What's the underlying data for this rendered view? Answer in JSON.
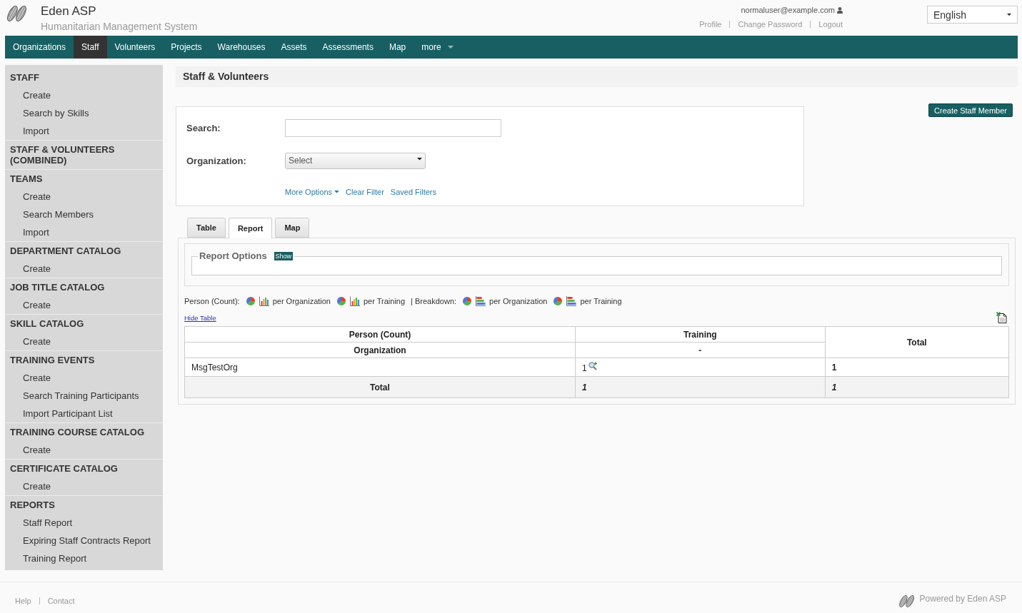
{
  "header": {
    "title": "Eden ASP",
    "subtitle": "Humanitarian Management System",
    "user_email": "normaluser@example.com",
    "user_links": [
      "Profile",
      "Change Password",
      "Logout"
    ],
    "language": "English"
  },
  "nav": [
    {
      "label": "Organizations",
      "kind": "link",
      "selected": false
    },
    {
      "label": "Staff",
      "kind": "link",
      "selected": true
    },
    {
      "label": "Volunteers",
      "kind": "link",
      "selected": false
    },
    {
      "label": "Projects",
      "kind": "link",
      "selected": false
    },
    {
      "label": "Warehouses",
      "kind": "link",
      "selected": false
    },
    {
      "label": "Assets",
      "kind": "link",
      "selected": false
    },
    {
      "label": "Assessments",
      "kind": "link",
      "selected": false
    },
    {
      "label": "Map",
      "kind": "link",
      "selected": false
    },
    {
      "label": "more",
      "kind": "menu",
      "selected": false
    }
  ],
  "sidebar": [
    {
      "heading": "STAFF",
      "items": [
        "Create",
        "Search by Skills",
        "Import"
      ]
    },
    {
      "heading": "STAFF & VOLUNTEERS (COMBINED)"
    },
    {
      "heading": "TEAMS",
      "items": [
        "Create",
        "Search Members",
        "Import"
      ]
    },
    {
      "heading": "DEPARTMENT CATALOG",
      "items": [
        "Create"
      ]
    },
    {
      "heading": "JOB TITLE CATALOG",
      "items": [
        "Create"
      ]
    },
    {
      "heading": "SKILL CATALOG",
      "items": [
        "Create"
      ]
    },
    {
      "heading": "TRAINING EVENTS",
      "items": [
        "Create",
        "Search Training Participants",
        "Import Participant List"
      ]
    },
    {
      "heading": "TRAINING COURSE CATALOG",
      "items": [
        "Create"
      ]
    },
    {
      "heading": "CERTIFICATE CATALOG",
      "items": [
        "Create"
      ]
    },
    {
      "heading": "REPORTS",
      "items": [
        "Staff Report",
        "Expiring Staff Contracts Report",
        "Training Report"
      ]
    }
  ],
  "page_title": "Staff & Volunteers",
  "create_button": "Create Staff Member",
  "filter_form": {
    "fields": [
      {
        "label": "Search:",
        "kind": "text"
      },
      {
        "label": "Organization:",
        "kind": "select",
        "value": "Select"
      }
    ],
    "links": [
      {
        "label": "More Options",
        "kind": "menu"
      },
      {
        "label": "Clear Filter",
        "kind": "link"
      },
      {
        "label": "Saved Filters",
        "kind": "link"
      }
    ]
  },
  "tabs": [
    {
      "label": "Table",
      "selected": false
    },
    {
      "label": "Report",
      "selected": true
    },
    {
      "label": "Map",
      "selected": false
    }
  ],
  "report_options": {
    "legend": "Report Options",
    "toggle": "Show"
  },
  "chart_options": [
    {
      "kind": "label",
      "text": "Person (Count):"
    },
    {
      "kind": "columns",
      "text": "per Organization"
    },
    {
      "kind": "columns",
      "text": "per Training"
    },
    {
      "kind": "label",
      "text": "| Breakdown:"
    },
    {
      "kind": "stacked",
      "text": "per Organization"
    },
    {
      "kind": "stacked",
      "text": "per Training"
    }
  ],
  "hide_table_link": "Hide Table",
  "report_table": {
    "columns": [
      {
        "label": "Person (Count)",
        "sublabel": "Organization"
      },
      {
        "label": "Training",
        "sublabel": "-"
      }
    ],
    "total_label": "Total",
    "rows": [
      {
        "cells": [
          "MsgTestOrg",
          "1",
          "1"
        ],
        "drilldown": true
      }
    ],
    "totals": [
      "Total",
      "1",
      "1"
    ]
  },
  "footer": {
    "links": [
      "Help",
      "Contact"
    ],
    "powered_by": "Powered by Eden ASP"
  }
}
